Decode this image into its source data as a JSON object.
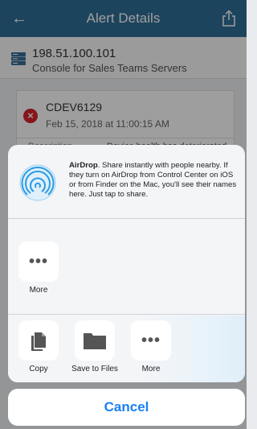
{
  "header": {
    "title": "Alert Details",
    "back_icon": "back-arrow-icon",
    "share_icon": "share-icon",
    "background": "#2f6f97"
  },
  "server": {
    "ip": "198.51.100.101",
    "description": "Console for Sales Teams Servers",
    "icon": "server-icon"
  },
  "alert": {
    "id": "CDEV6129",
    "timestamp": "Feb 15, 2018 at 11:00:15 AM",
    "description_label": "Description",
    "description_value": "Device health has deteriorated",
    "status_color": "#d9252c"
  },
  "airdrop": {
    "title": "AirDrop",
    "text": ". Share instantly with people nearby. If they turn on AirDrop from Control Center on iOS or from Finder on the Mac, you'll see their names here. Just tap to share.",
    "icon": "airdrop-icon"
  },
  "share_row": [
    {
      "label": "More",
      "icon": "more-icon"
    }
  ],
  "action_row": [
    {
      "label": "Copy",
      "icon": "copy-icon"
    },
    {
      "label": "Save to Files",
      "icon": "folder-icon"
    },
    {
      "label": "More",
      "icon": "more-icon"
    }
  ],
  "cancel": {
    "label": "Cancel",
    "color": "#1a7ff5"
  }
}
